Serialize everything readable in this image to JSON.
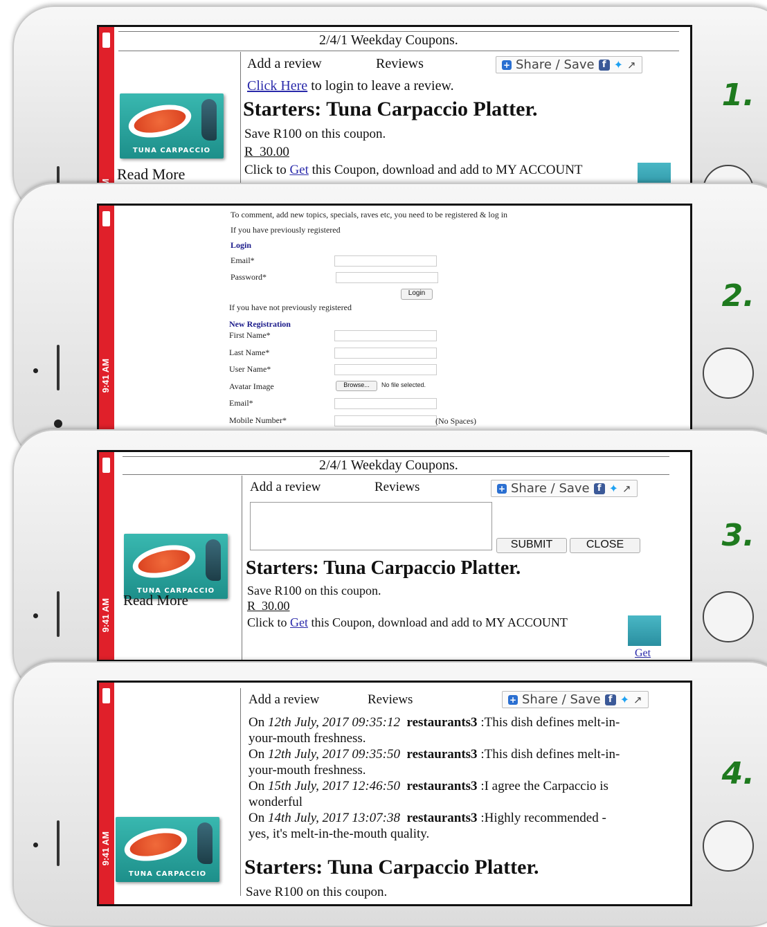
{
  "steps": [
    "1.",
    "2.",
    "3.",
    "4."
  ],
  "status": {
    "time": "9:41 AM",
    "time_short": "M"
  },
  "coupon": {
    "header": "2/4/1 Weekday Coupons.",
    "add_review": "Add a review",
    "reviews": "Reviews",
    "share": "Share / Save",
    "login_link": "Click Here",
    "login_text": " to login to leave a review.",
    "title": "Starters: Tuna Carpaccio Platter.",
    "save_text": "Save R100 on this coupon.",
    "price": "R  30.00",
    "click_to": "Click to ",
    "get_link": "Get",
    "download_text": " this Coupon, download and add to MY ACCOUNT",
    "read_more": "Read More",
    "logo_label": "TUNA CARPACCIO",
    "get_label": "Get",
    "save_cut": "Save R100 on this coupon."
  },
  "form": {
    "intro": "To comment, add new topics, specials, raves etc, you need to be registered & log in",
    "prev_registered": "If you have previously registered",
    "login_heading": "Login",
    "email_label": "Email*",
    "password_label": "Password*",
    "login_button": "Login",
    "not_registered": "If you have not previously registered",
    "new_reg_heading": "New Registration",
    "first_name": "First Name*",
    "last_name": "Last Name*",
    "user_name": "User Name*",
    "avatar": "Avatar Image",
    "browse": "Browse...",
    "no_file": "No file selected.",
    "email2": "Email*",
    "mobile": "Mobile Number*",
    "no_spaces": "(No Spaces)"
  },
  "review_form": {
    "submit": "SUBMIT",
    "close": "CLOSE"
  },
  "reviews_list": [
    {
      "date": "12th July, 2017 09:35:12",
      "user": "restaurants3",
      "line1": ":This dish defines melt-in-",
      "line2": "your-mouth freshness."
    },
    {
      "date": "12th July, 2017 09:35:50",
      "user": "restaurants3",
      "line1": ":This dish defines melt-in-",
      "line2": "your-mouth freshness."
    },
    {
      "date": "15th July, 2017 12:46:50",
      "user": "restaurants3",
      "line1": ":I agree the Carpaccio is",
      "line2": "wonderful"
    },
    {
      "date": "14th July, 2017 13:07:38",
      "user": "restaurants3",
      "line1": ":Highly recommended -",
      "line2": "yes, it's melt-in-the-mouth quality."
    }
  ],
  "on_label": "On "
}
